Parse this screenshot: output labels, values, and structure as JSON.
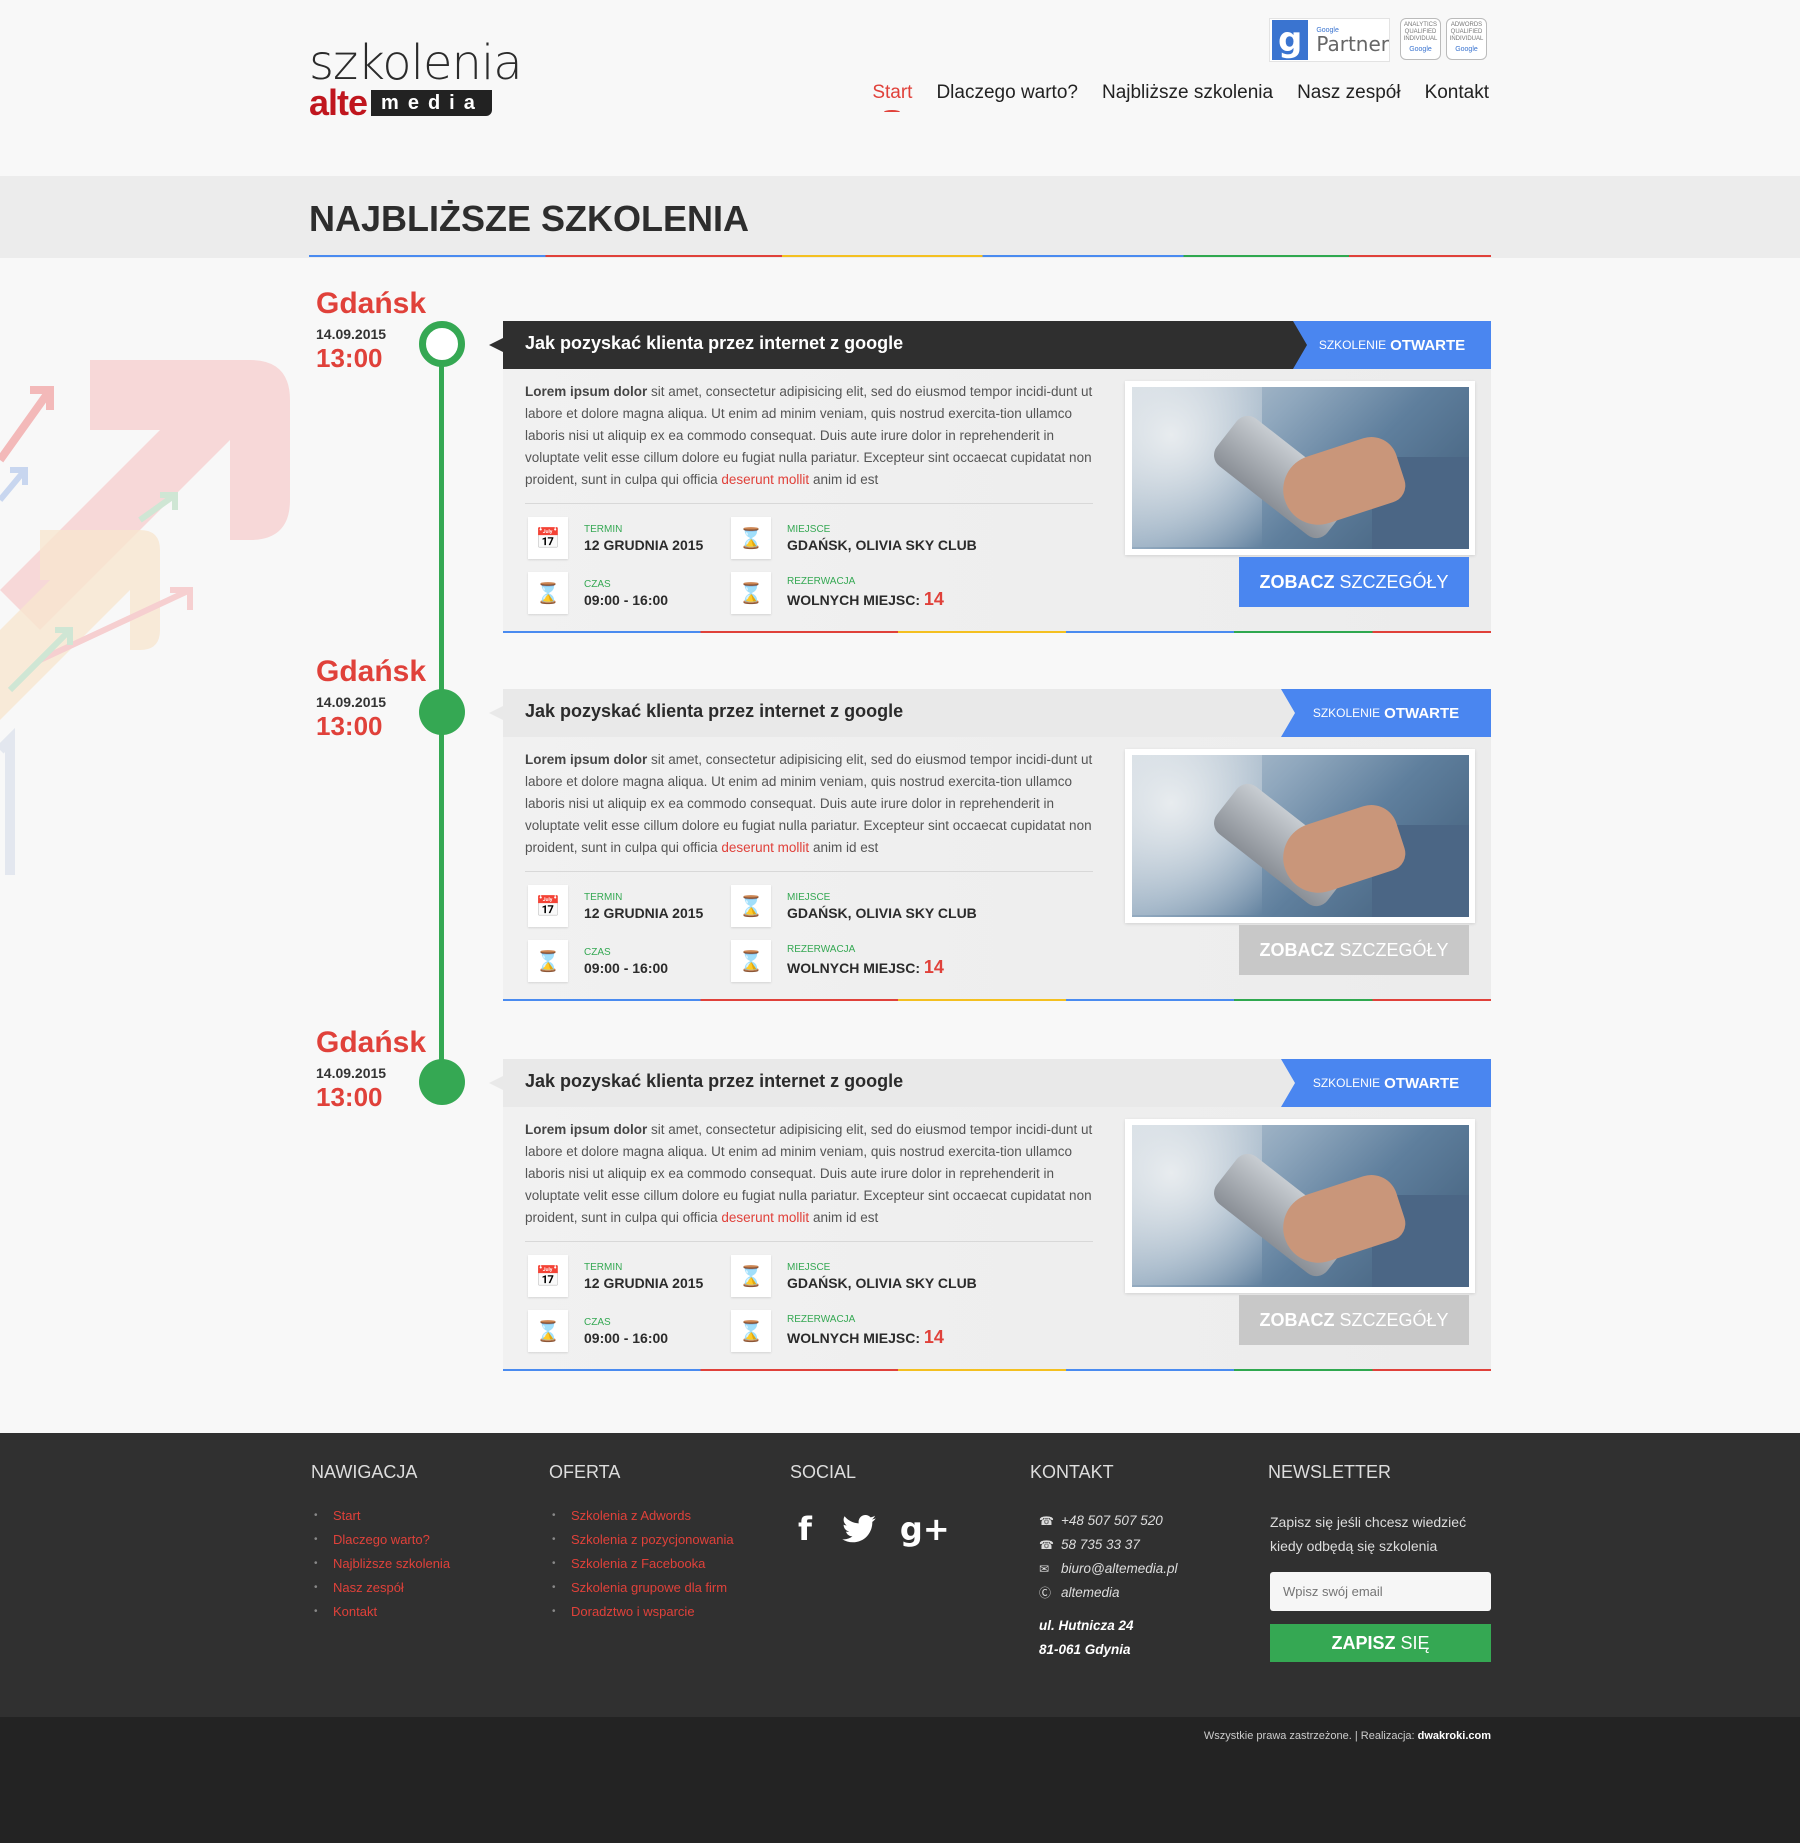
{
  "header": {
    "logo_top": "szkolenia",
    "logo_alte": "alte",
    "logo_media": "media",
    "partner_small": "Google",
    "partner_big": "Partner",
    "badge1": [
      "ANALYTICS",
      "QUALIFIED",
      "INDIVIDUAL"
    ],
    "badge2": [
      "ADWORDS",
      "QUALIFIED",
      "INDIVIDUAL"
    ],
    "badge_google": "Google",
    "nav": [
      "Start",
      "Dlaczego warto?",
      "Najbliższe szkolenia",
      "Nasz zespół",
      "Kontakt"
    ],
    "nav_active": 0
  },
  "page_title": "NAJBLIŻSZE SZKOLENIA",
  "colors": {
    "accent_red": "#e0413a",
    "accent_blue": "#4a86f0",
    "accent_green": "#35a853",
    "dark": "#2f2f2f"
  },
  "events": [
    {
      "city": "Gdańsk",
      "date": "14.09.2015",
      "time": "13:00",
      "title": "Jak pozyskać klienta przez internet z google",
      "tag_prefix": "SZKOLENIE",
      "tag_status": "OTWARTE",
      "text_bold": "Lorem ipsum dolor",
      "text_main": " sit amet, consectetur adipisicing elit, sed do eiusmod tempor incidi-dunt ut labore et dolore magna aliqua. Ut enim ad minim veniam, quis nostrud exercita-tion ullamco laboris nisi ut aliquip ex ea commodo consequat. Duis aute irure dolor in reprehenderit in voluptate velit esse cillum dolore eu fugiat nulla pariatur. Excepteur sint occaecat cupidatat non proident, sunt in culpa qui officia ",
      "text_red": "deserunt mollit",
      "text_end": " anim id est",
      "termin_label": "TERMIN",
      "termin_value": "12 GRUDNIA 2015",
      "miejsce_label": "MIEJSCE",
      "miejsce_value": "GDAŃSK, OLIVIA SKY CLUB",
      "czas_label": "CZAS",
      "czas_value": "09:00 - 16:00",
      "rezerwacja_label": "REZERWACJA",
      "rezerwacja_value": "WOLNYCH MIEJSC:",
      "rezerwacja_count": "14",
      "button_bold": "ZOBACZ",
      "button_rest": "SZCZEGÓŁY",
      "highlighted": true
    },
    {
      "city": "Gdańsk",
      "date": "14.09.2015",
      "time": "13:00",
      "title": "Jak pozyskać klienta przez internet z google",
      "tag_prefix": "SZKOLENIE",
      "tag_status": "OTWARTE",
      "text_bold": "Lorem ipsum dolor",
      "text_main": " sit amet, consectetur adipisicing elit, sed do eiusmod tempor incidi-dunt ut labore et dolore magna aliqua. Ut enim ad minim veniam, quis nostrud exercita-tion ullamco laboris nisi ut aliquip ex ea commodo consequat. Duis aute irure dolor in reprehenderit in voluptate velit esse cillum dolore eu fugiat nulla pariatur. Excepteur sint occaecat cupidatat non proident, sunt in culpa qui officia ",
      "text_red": "deserunt mollit",
      "text_end": " anim id est",
      "termin_label": "TERMIN",
      "termin_value": "12 GRUDNIA 2015",
      "miejsce_label": "MIEJSCE",
      "miejsce_value": "GDAŃSK, OLIVIA SKY CLUB",
      "czas_label": "CZAS",
      "czas_value": "09:00 - 16:00",
      "rezerwacja_label": "REZERWACJA",
      "rezerwacja_value": "WOLNYCH MIEJSC:",
      "rezerwacja_count": "14",
      "button_bold": "ZOBACZ",
      "button_rest": "SZCZEGÓŁY",
      "highlighted": false
    },
    {
      "city": "Gdańsk",
      "date": "14.09.2015",
      "time": "13:00",
      "title": "Jak pozyskać klienta przez internet z google",
      "tag_prefix": "SZKOLENIE",
      "tag_status": "OTWARTE",
      "text_bold": "Lorem ipsum dolor",
      "text_main": " sit amet, consectetur adipisicing elit, sed do eiusmod tempor incidi-dunt ut labore et dolore magna aliqua. Ut enim ad minim veniam, quis nostrud exercita-tion ullamco laboris nisi ut aliquip ex ea commodo consequat. Duis aute irure dolor in reprehenderit in voluptate velit esse cillum dolore eu fugiat nulla pariatur. Excepteur sint occaecat cupidatat non proident, sunt in culpa qui officia ",
      "text_red": "deserunt mollit",
      "text_end": " anim id est",
      "termin_label": "TERMIN",
      "termin_value": "12 GRUDNIA 2015",
      "miejsce_label": "MIEJSCE",
      "miejsce_value": "GDAŃSK, OLIVIA SKY CLUB",
      "czas_label": "CZAS",
      "czas_value": "09:00 - 16:00",
      "rezerwacja_label": "REZERWACJA",
      "rezerwacja_value": "WOLNYCH MIEJSC:",
      "rezerwacja_count": "14",
      "button_bold": "ZOBACZ",
      "button_rest": "SZCZEGÓŁY",
      "highlighted": false
    }
  ],
  "footer": {
    "nav_title": "NAWIGACJA",
    "nav_items": [
      "Start",
      "Dlaczego warto?",
      "Najbliższe szkolenia",
      "Nasz zespół",
      "Kontakt"
    ],
    "offer_title": "OFERTA",
    "offer_items": [
      "Szkolenia z Adwords",
      "Szkolenia z pozycjonowania",
      "Szkolenia z Facebooka",
      "Szkolenia grupowe dla firm",
      "Doradztwo i wsparcie"
    ],
    "social_title": "SOCIAL",
    "social_icons": [
      "facebook-icon",
      "twitter-icon",
      "google-plus-icon"
    ],
    "contact_title": "KONTAKT",
    "phone1": "+48 507 507 520",
    "phone2": "58 735 33 37",
    "email": "biuro@altemedia.pl",
    "skype": "altemedia",
    "address1": "ul. Hutnicza 24",
    "address2": "81-061 Gdynia",
    "newsletter_title": "NEWSLETTER",
    "newsletter_text": "Zapisz się jeśli chcesz wiedzieć kiedy odbędą się szkolenia",
    "newsletter_placeholder": "Wpisz swój email",
    "newsletter_btn_bold": "ZAPISZ",
    "newsletter_btn_rest": "SIĘ",
    "copyright": "Wszystkie prawa zastrzeżone.",
    "realization_label": "|  Realizacja:",
    "realization_link": "dwakroki.com"
  }
}
